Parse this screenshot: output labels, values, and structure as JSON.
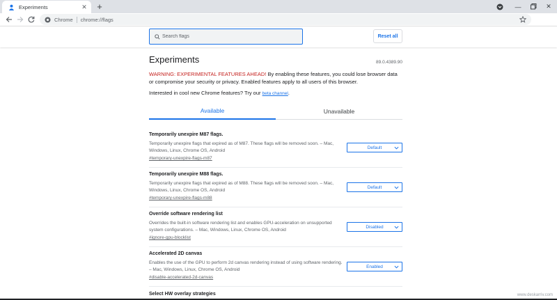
{
  "browser": {
    "tab_title": "Experiments",
    "omnibox_chip": "Chrome",
    "url": "chrome://flags"
  },
  "header": {
    "search_placeholder": "Search flags",
    "reset_all_label": "Reset all"
  },
  "page": {
    "title": "Experiments",
    "version": "89.0.4389.90",
    "warning_red": "WARNING: EXPERIMENTAL FEATURES AHEAD!",
    "warning_text": " By enabling these features, you could lose browser data or compromise your security or privacy. Enabled features apply to all users of this browser.",
    "interest_text": "Interested in cool new Chrome features? Try our ",
    "beta_link": "beta channel",
    "interest_end": "."
  },
  "tabs": {
    "available": "Available",
    "unavailable": "Unavailable"
  },
  "flags": [
    {
      "title": "Temporarily unexpire M87 flags.",
      "description": "Temporarily unexpire flags that expired as of M87. These flags will be removed soon. – Mac, Windows, Linux, Chrome OS, Android",
      "link": "#temporary-unexpire-flags-m87",
      "value": "Default"
    },
    {
      "title": "Temporarily unexpire M88 flags.",
      "description": "Temporarily unexpire flags that expired as of M88. These flags will be removed soon. – Mac, Windows, Linux, Chrome OS, Android",
      "link": "#temporary-unexpire-flags-m88",
      "value": "Default"
    },
    {
      "title": "Override software rendering list",
      "description": "Overrides the built-in software rendering list and enables GPU-acceleration on unsupported system configurations. – Mac, Windows, Linux, Chrome OS, Android",
      "link": "#ignore-gpu-blocklist",
      "value": "Disabled"
    },
    {
      "title": "Accelerated 2D canvas",
      "description": "Enables the use of the GPU to perform 2d canvas rendering instead of using software rendering. – Mac, Windows, Linux, Chrome OS, Android",
      "link": "#disable-accelerated-2d-canvas",
      "value": "Enabled"
    },
    {
      "title": "Select HW overlay strategies"
    }
  ],
  "watermark": "www.deskarriv.com",
  "colors": {
    "accent": "#1a73e8",
    "warning": "#c5221f",
    "tabstrip": "#dee1e6"
  }
}
